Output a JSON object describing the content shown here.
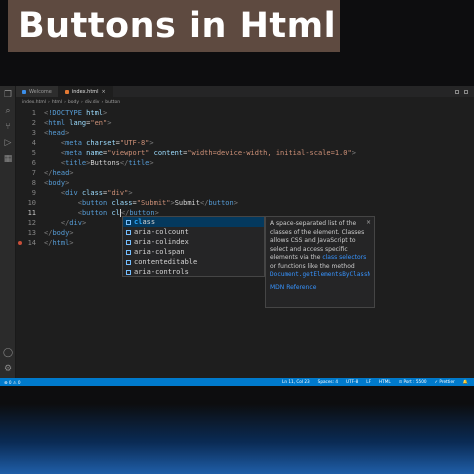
{
  "banner": {
    "title": "Buttons in Html"
  },
  "tabs": [
    {
      "label": "Welcome",
      "active": false
    },
    {
      "label": "index.html",
      "active": true
    }
  ],
  "breadcrumb": [
    "index.html",
    "html",
    "body",
    "div.div",
    "button"
  ],
  "code_lines": [
    {
      "n": "1",
      "parts": [
        [
          "pu",
          "<"
        ],
        [
          "tg",
          "!DOCTYPE"
        ],
        [
          "at",
          " html"
        ],
        [
          "pu",
          ">"
        ]
      ]
    },
    {
      "n": "2",
      "parts": [
        [
          "pu",
          "<"
        ],
        [
          "tg",
          "html"
        ],
        [
          "at",
          " lang"
        ],
        [
          "tx",
          "="
        ],
        [
          "st",
          "\"en\""
        ],
        [
          "pu",
          ">"
        ]
      ]
    },
    {
      "n": "3",
      "parts": [
        [
          "pu",
          "<"
        ],
        [
          "tg",
          "head"
        ],
        [
          "pu",
          ">"
        ]
      ]
    },
    {
      "n": "4",
      "parts": [
        [
          "tx",
          "    "
        ],
        [
          "pu",
          "<"
        ],
        [
          "tg",
          "meta"
        ],
        [
          "at",
          " charset"
        ],
        [
          "tx",
          "="
        ],
        [
          "st",
          "\"UTF-8\""
        ],
        [
          "pu",
          ">"
        ]
      ]
    },
    {
      "n": "5",
      "parts": [
        [
          "tx",
          "    "
        ],
        [
          "pu",
          "<"
        ],
        [
          "tg",
          "meta"
        ],
        [
          "at",
          " name"
        ],
        [
          "tx",
          "="
        ],
        [
          "st",
          "\"viewport\""
        ],
        [
          "at",
          " content"
        ],
        [
          "tx",
          "="
        ],
        [
          "st",
          "\"width=device-width, initial-scale=1.0\""
        ],
        [
          "pu",
          ">"
        ]
      ]
    },
    {
      "n": "6",
      "parts": [
        [
          "tx",
          "    "
        ],
        [
          "pu",
          "<"
        ],
        [
          "tg",
          "title"
        ],
        [
          "pu",
          ">"
        ],
        [
          "tx",
          "Buttons"
        ],
        [
          "pu",
          "</"
        ],
        [
          "tg",
          "title"
        ],
        [
          "pu",
          ">"
        ]
      ]
    },
    {
      "n": "7",
      "parts": [
        [
          "pu",
          "</"
        ],
        [
          "tg",
          "head"
        ],
        [
          "pu",
          ">"
        ]
      ]
    },
    {
      "n": "8",
      "parts": [
        [
          "pu",
          "<"
        ],
        [
          "tg",
          "body"
        ],
        [
          "pu",
          ">"
        ]
      ]
    },
    {
      "n": "9",
      "parts": [
        [
          "tx",
          "    "
        ],
        [
          "pu",
          "<"
        ],
        [
          "tg",
          "div"
        ],
        [
          "at",
          " class"
        ],
        [
          "tx",
          "="
        ],
        [
          "st",
          "\"div\""
        ],
        [
          "pu",
          ">"
        ]
      ]
    },
    {
      "n": "10",
      "parts": [
        [
          "tx",
          "        "
        ],
        [
          "pu",
          "<"
        ],
        [
          "tg",
          "button"
        ],
        [
          "at",
          " class"
        ],
        [
          "tx",
          "="
        ],
        [
          "st",
          "\"Submit\""
        ],
        [
          "pu",
          ">"
        ],
        [
          "tx",
          "Submit"
        ],
        [
          "pu",
          "</"
        ],
        [
          "tg",
          "button"
        ],
        [
          "pu",
          ">"
        ]
      ]
    },
    {
      "n": "11",
      "parts": [
        [
          "tx",
          "        "
        ],
        [
          "pu",
          "<"
        ],
        [
          "tg",
          "button"
        ],
        [
          "at",
          " cl"
        ],
        [
          "cur",
          ""
        ],
        [
          "pu",
          "</"
        ],
        [
          "tg",
          "button"
        ],
        [
          "pu",
          ">"
        ]
      ]
    },
    {
      "n": "12",
      "parts": [
        [
          "tx",
          "    "
        ],
        [
          "pu",
          "</"
        ],
        [
          "tg",
          "div"
        ],
        [
          "pu",
          ">"
        ]
      ]
    },
    {
      "n": "13",
      "parts": [
        [
          "pu",
          "</"
        ],
        [
          "tg",
          "body"
        ],
        [
          "pu",
          ">"
        ]
      ]
    },
    {
      "n": "14",
      "parts": [
        [
          "pu",
          "</"
        ],
        [
          "tg",
          "html"
        ],
        [
          "pu",
          ">"
        ]
      ]
    }
  ],
  "current_line": "11",
  "breakpoint_line": "14",
  "suggestions": [
    {
      "hl": "cl",
      "rest": "ass",
      "selected": true
    },
    {
      "hl": "",
      "rest": "aria-colcount",
      "selected": false
    },
    {
      "hl": "",
      "rest": "aria-colindex",
      "selected": false
    },
    {
      "hl": "",
      "rest": "aria-colspan",
      "selected": false
    },
    {
      "hl": "",
      "rest": "contenteditable",
      "selected": false
    },
    {
      "hl": "",
      "rest": "aria-controls",
      "selected": false
    }
  ],
  "details": {
    "text1": "A space-separated list of the classes of the element. Classes allows CSS and JavaScript to select and access specific elements via the ",
    "link1": "class selectors",
    "text2": " or functions like the method",
    "code": "Document.getElementsByClassName",
    "ref": "MDN Reference",
    "close": "×"
  },
  "status": {
    "left": [
      "⊗ 0 ⚠ 0"
    ],
    "right": [
      "Ln 11, Col 23",
      "Spaces: 4",
      "UTF-8",
      "LF",
      "HTML",
      "⊙ Port : 5500",
      "✓ Prettier",
      "🔔"
    ]
  },
  "colors": {
    "accent": "#007acc",
    "banner": "#5e4a40"
  }
}
